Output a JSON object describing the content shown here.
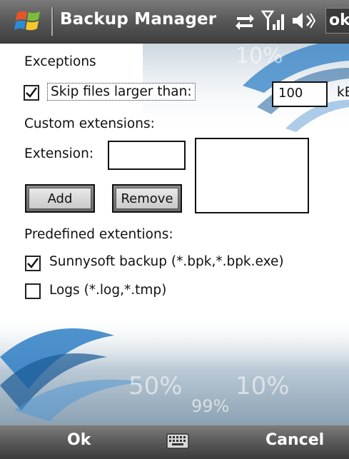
{
  "titlebar": {
    "title": "Backup Manager",
    "ok": "ok"
  },
  "exceptions": {
    "heading": "Exceptions",
    "skip_label": "Skip files larger than:",
    "skip_checked": true,
    "size_value": "100",
    "unit": "kB"
  },
  "custom": {
    "heading": "Custom extensions:",
    "extension_label": "Extension:",
    "extension_value": "",
    "add_label": "Add",
    "remove_label": "Remove"
  },
  "predefined": {
    "heading": "Predefined extentions:",
    "items": [
      {
        "label": "Sunnysoft backup (*.bpk,*.bpk.exe)",
        "checked": true
      },
      {
        "label": "Logs (*.log,*.tmp)",
        "checked": false
      }
    ]
  },
  "background": {
    "percent_a": "50%",
    "percent_b": "10%",
    "percent_c": "99%",
    "percent_top": "10%"
  },
  "softkeys": {
    "left": "Ok",
    "right": "Cancel"
  },
  "icons": [
    "windows-start-icon",
    "connectivity-icon",
    "signal-icon",
    "volume-icon",
    "keyboard-icon",
    "checkmark-icon"
  ],
  "colors": {
    "titlebar": "#5a5a5a",
    "bottombar": "#5c5c5c",
    "accent_blue": "#2f7fc4"
  }
}
